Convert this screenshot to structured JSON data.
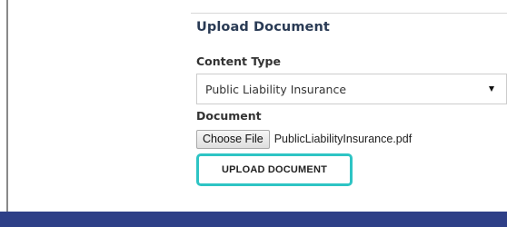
{
  "form": {
    "heading": "Upload Document",
    "content_type": {
      "label": "Content Type",
      "selected": "Public Liability Insurance"
    },
    "document": {
      "label": "Document",
      "choose_button_label": "Choose File",
      "file_name": "PublicLiabilityInsurance.pdf"
    },
    "submit_label": "UPLOAD DOCUMENT"
  },
  "colors": {
    "heading_text": "#2a3b55",
    "highlight_outline": "#2ec4c4",
    "footer_bar": "#2e3f87"
  }
}
